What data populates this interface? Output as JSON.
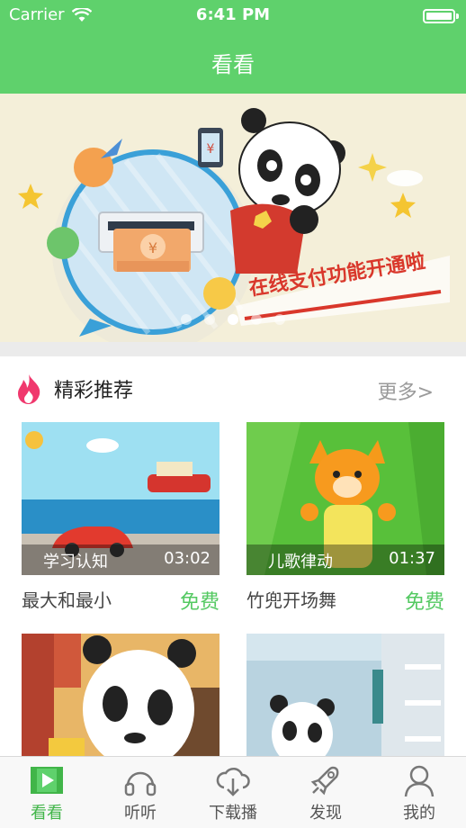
{
  "status_bar": {
    "carrier": "Carrier",
    "time": "6:41 PM"
  },
  "nav": {
    "title": "看看"
  },
  "banner": {
    "slogan": "在线支付功能开通啦",
    "currency_symbol": "¥",
    "dots": 5,
    "active_dot": 3
  },
  "section": {
    "title": "精彩推荐",
    "more_label": "更多>"
  },
  "videos": [
    {
      "category": "学习认知",
      "duration": "03:02",
      "name": "最大和最小",
      "price": "免费"
    },
    {
      "category": "儿歌律动",
      "duration": "01:37",
      "name": "竹兜开场舞",
      "price": "免费"
    },
    {
      "category": "",
      "duration": "",
      "name": "",
      "price": ""
    },
    {
      "category": "",
      "duration": "",
      "name": "",
      "price": ""
    }
  ],
  "tabs": [
    {
      "label": "看看",
      "icon": "video-play-icon",
      "active": true
    },
    {
      "label": "听听",
      "icon": "headphones-icon",
      "active": false
    },
    {
      "label": "下载播",
      "icon": "cloud-download-icon",
      "active": false
    },
    {
      "label": "发现",
      "icon": "rocket-icon",
      "active": false
    },
    {
      "label": "我的",
      "icon": "person-icon",
      "active": false
    }
  ],
  "colors": {
    "brand_green": "#5fd16c",
    "free_green": "#54c962",
    "active_tab": "#41b549"
  }
}
